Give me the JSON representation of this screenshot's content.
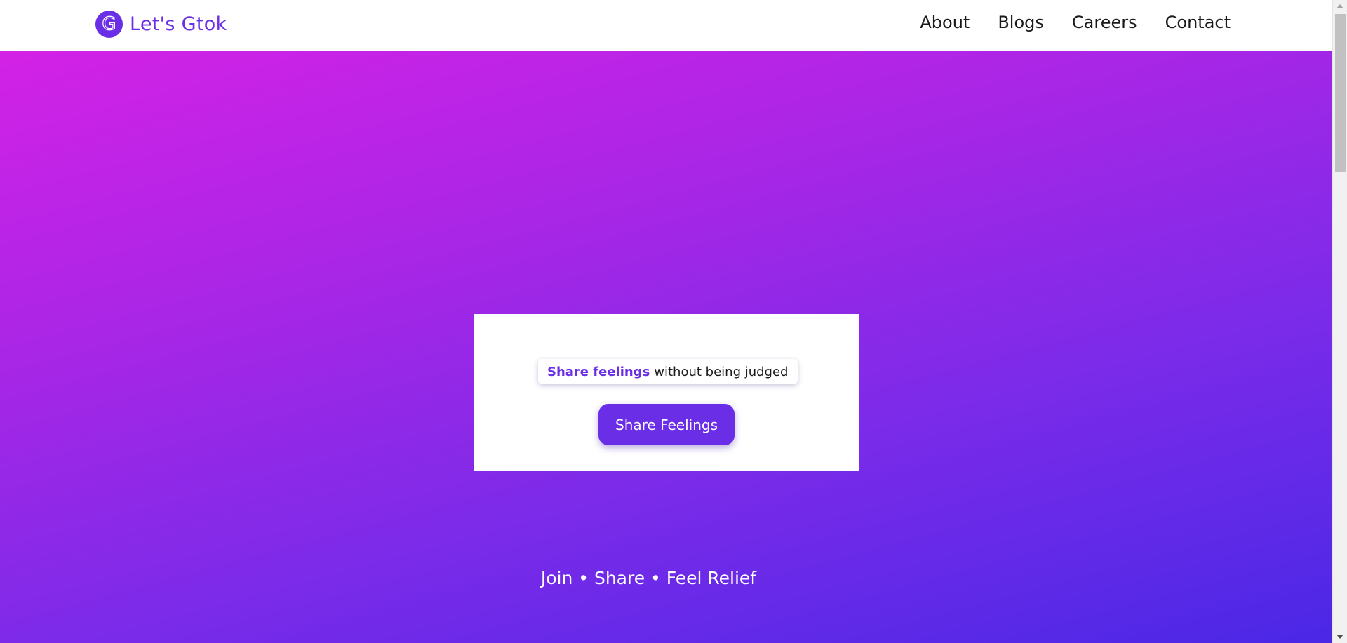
{
  "header": {
    "brand": {
      "logo_letter": "G",
      "name": "Let's Gtok"
    },
    "nav": [
      {
        "label": "About"
      },
      {
        "label": "Blogs"
      },
      {
        "label": "Careers"
      },
      {
        "label": "Contact"
      }
    ]
  },
  "hero": {
    "card": {
      "pill_strong": "Share feelings",
      "pill_rest": "without being judged",
      "cta_label": "Share Feelings"
    },
    "tagline": "Join • Share • Feel Relief"
  },
  "colors": {
    "accent": "#6a2ee6",
    "gradient_start": "#d322e6",
    "gradient_end": "#4a28e6",
    "text_dark": "#1a1a1a",
    "white": "#ffffff"
  }
}
